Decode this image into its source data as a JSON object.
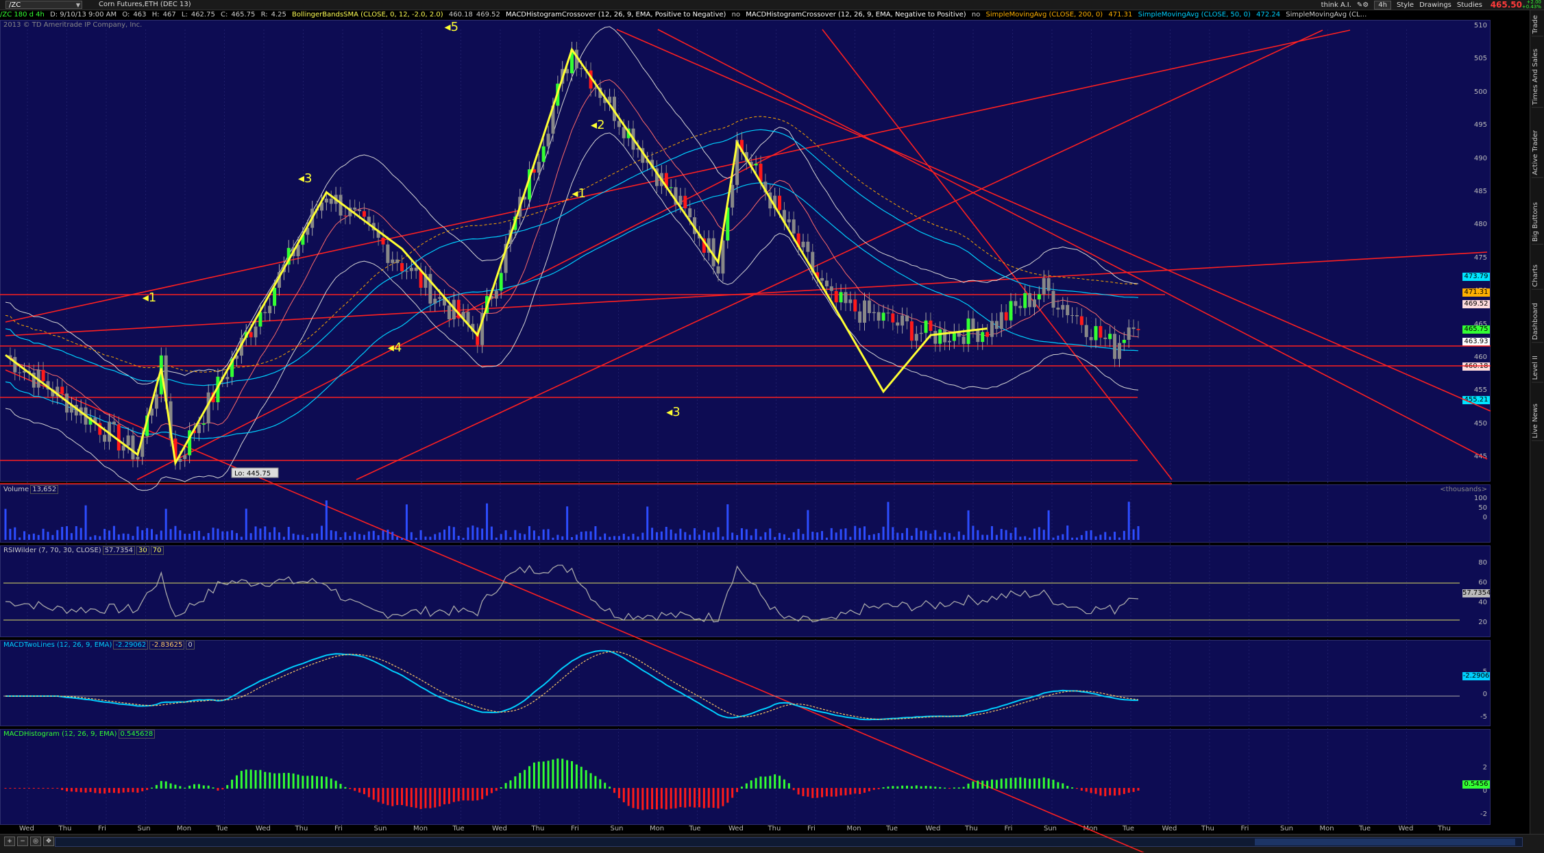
{
  "toolbar": {
    "symbol": "/ZC",
    "description": "Corn Futures,ETH (DEC 13)",
    "think": "think A.I.",
    "aggregation": "4h",
    "style": "Style",
    "drawings": "Drawings",
    "studies": "Studies",
    "last_price": "465.50",
    "change_line1": "+2.00",
    "change_line2": "+0.43%"
  },
  "header": {
    "symbol": "/ZC 180 d 4h",
    "date": "D: 9/10/13 9:00 AM",
    "o_label": "O:",
    "o": "463",
    "h_label": "H:",
    "h": "467",
    "l_label": "L:",
    "l": "462.75",
    "c_label": "C:",
    "c": "465.75",
    "r_label": "R:",
    "r": "4.25",
    "bb": "BollingerBandsSMA (CLOSE, 0, 12, -2.0, 2.0)",
    "bb_v1": "460.18",
    "bb_v2": "469.52",
    "macd_neg": "MACDHistogramCrossover (12, 26, 9, EMA, Positive to Negative)",
    "macd_neg_v": "no",
    "macd_pos": "MACDHistogramCrossover (12, 26, 9, EMA, Negative to Positive)",
    "macd_pos_v": "no",
    "sma200": "SimpleMovingAvg (CLOSE, 200, 0)",
    "sma200_v": "471.31",
    "sma50": "SimpleMovingAvg (CLOSE, 50, 0)",
    "sma50_v": "472.24",
    "sma_cut": "SimpleMovingAvg (CL..."
  },
  "copyright": "2013 © TD Ameritrade IP Company, Inc.",
  "price_pane": {
    "ticks": [
      "510",
      "505",
      "500",
      "495",
      "490",
      "485",
      "480",
      "475",
      "470",
      "465",
      "460",
      "455",
      "450",
      "445"
    ],
    "labels": [
      {
        "text": "473.79",
        "bg": "#00e5ff"
      },
      {
        "text": "471.31",
        "bg": "#ffb000"
      },
      {
        "text": "469.52",
        "bg": "#ffdddd"
      },
      {
        "text": "465.75",
        "bg": "#33ff33"
      },
      {
        "text": "463.93",
        "bg": "#ffffff"
      },
      {
        "text": "460.18",
        "bg": "#ffdddd"
      },
      {
        "text": "455.21",
        "bg": "#00e5ff"
      }
    ],
    "low_label": "Lo: 445.75",
    "wave_labels": [
      "1",
      "3",
      "4",
      "5",
      "1",
      "2",
      "3"
    ]
  },
  "volume_pane": {
    "title": "Volume",
    "value": "13,652",
    "units": "<thousands>",
    "ticks": [
      "100",
      "50",
      "0"
    ]
  },
  "rsi_pane": {
    "title": "RSIWilder (7, 70, 30, CLOSE)",
    "value": "57.7354",
    "os": "30",
    "ob": "70",
    "ticks": [
      "80",
      "60",
      "40",
      "20"
    ],
    "label": "57.7354"
  },
  "macd_pane": {
    "title": "MACDTwoLines (12, 26, 9, EMA)",
    "value": "-2.29062",
    "avg": "-2.83625",
    "zero": "0",
    "ticks": [
      "5",
      "0",
      "-5"
    ],
    "label": "-2.2906"
  },
  "hist_pane": {
    "title": "MACDHistogram (12, 26, 9, EMA)",
    "value": "0.545628",
    "ticks": [
      "2",
      "0",
      "-2"
    ],
    "label": "0.5456"
  },
  "dates": [
    "Wed",
    "Thu",
    "Fri",
    "Sun",
    "Mon",
    "Tue",
    "Wed",
    "Thu",
    "Fri",
    "Sun",
    "Mon",
    "Tue",
    "Wed",
    "Thu",
    "Fri",
    "Sun",
    "Mon",
    "Tue",
    "Wed",
    "Thu",
    "Fri",
    "Mon",
    "Tue",
    "Wed",
    "Thu",
    "Fri",
    "Sun",
    "Mon",
    "Tue",
    "Wed",
    "Thu",
    "Fri",
    "Sun",
    "Mon",
    "Tue",
    "Wed",
    "Thu"
  ],
  "sidebar": [
    "Trade",
    "Times And Sales",
    "Active Trader",
    "Big Buttons",
    "Charts",
    "Dashboard",
    "Level II",
    "Live News"
  ],
  "colors": {
    "bg": "#0d0c53",
    "up": "#33ff33",
    "down": "#ff1a1a",
    "wave": "#ffff33",
    "channel": "#ff2020",
    "bb": "#d8d8d8",
    "ma": "#00d0ff"
  }
}
